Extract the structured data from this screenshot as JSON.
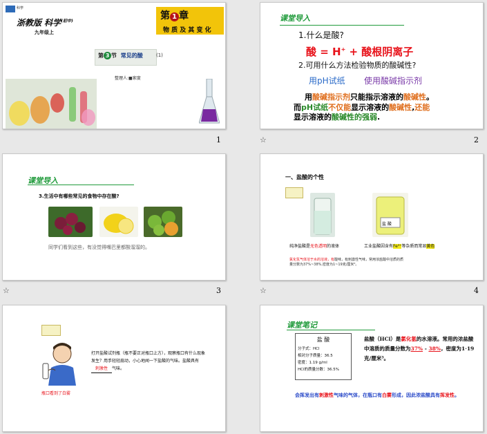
{
  "slides": [
    {
      "number": "1",
      "book_title": "浙教版 科学",
      "book_sub": "(初中)",
      "grade": "九年级上",
      "chapter_label_pre": "第",
      "chapter_number": "1",
      "chapter_label_post": "章",
      "chapter_name": "物 质 及 其 变 化",
      "section_pre": "第",
      "section_number": "3",
      "section_post": "节",
      "section_name": "常见的酸",
      "section_part": "(1)",
      "author": "整理人:■家度",
      "logo_text": "科学"
    },
    {
      "number": "2",
      "heading": "课堂导入",
      "q1": "1.什么是酸?",
      "acid_def_a": "酸 = H",
      "acid_def_sup": "+",
      "acid_def_b": " + 酸根阴离子",
      "q2": "2.可用什么方法检验物质的酸碱性?",
      "method1": "用pH试纸",
      "method2": "使用酸碱指示剂",
      "p_line1": [
        {
          "t": "用",
          "c": "#000000"
        },
        {
          "t": "酸碱指示剂",
          "c": "#e07020"
        },
        {
          "t": "只能指示溶液的",
          "c": "#000000"
        },
        {
          "t": "酸碱性",
          "c": "#e07020"
        },
        {
          "t": "。",
          "c": "#000000"
        }
      ],
      "p_line2": [
        {
          "t": "而",
          "c": "#000000"
        },
        {
          "t": "pH试纸",
          "c": "#2a8a2a"
        },
        {
          "t": "不仅能",
          "c": "#e07020"
        },
        {
          "t": "显示溶液的",
          "c": "#000000"
        },
        {
          "t": "酸碱性",
          "c": "#e07020"
        },
        {
          "t": ",",
          "c": "#000000"
        },
        {
          "t": "还能",
          "c": "#e07020"
        }
      ],
      "p_line3": [
        {
          "t": "显示溶液的",
          "c": "#000000"
        },
        {
          "t": "酸碱性的强弱",
          "c": "#2a8a2a"
        },
        {
          "t": ".",
          "c": "#000000"
        }
      ]
    },
    {
      "number": "3",
      "heading": "课堂导入",
      "q3": "3.生活中有哪些常见的食物中存在酸?",
      "caption": "同学们看到这些，有没觉得嘴巴里都酸溜溜的。"
    },
    {
      "number": "4",
      "heading": "一、盐酸的个性",
      "bottle_label": "盐 酸",
      "cap_left_a": "纯净盐酸是",
      "cap_left_b": "无色透明",
      "cap_left_c": "的液体",
      "cap_right_a": "工业盐酸因含有",
      "cap_right_b": "Fe³⁺",
      "cap_right_c": "等杂质而常显",
      "cap_right_d": "黄色",
      "note_red": "氯化氢气体溶于水的溶液，有",
      "note_rest": "酸味，有刺激性气味，常用浓盐酸中溶质的质量分数为37%~38%,密度为1~19克/厘米³。"
    },
    {
      "number": "",
      "instruction": "打开盐酸试剂瓶（瓶不要正对瓶口上方），观察瓶口有什么现象发生？用手轻轻扇动，小心地闻一下盐酸的气味。盐酸具有",
      "blank": "刺激性",
      "instruction_end": "气味。",
      "red_caption": "瓶口看到了白雾"
    },
    {
      "number": "",
      "heading": "课堂笔记",
      "box_title": "盐  酸",
      "box_lines": [
        "分子式：HCl",
        "相对分子质量：36.5",
        "密度：1.19 g/ml",
        "HCl的质量分数：36.5%"
      ],
      "para_a": "盐酸（HCl）是",
      "para_red": "氯化氢",
      "para_b": "的水溶液。常用的浓盐酸中溶质的质量分数为",
      "para_u1": "37%",
      "para_dash": " - ",
      "para_u2": "38%",
      "para_c": "，密度为1·19克/厘米³。",
      "blue_a": "会挥发出有",
      "blue_red1": "刺激性",
      "blue_b": "气味的气体，在瓶口有",
      "blue_red2": "白雾",
      "blue_c": "形成，因此浓盐酸具有",
      "blue_red3": "挥发性",
      "blue_d": "。"
    }
  ],
  "colors": {
    "green_heading": "#1f9a3a",
    "red": "#e8121a",
    "blue": "#2a6ac8",
    "orange": "#e07020",
    "purple": "#7a3aa8",
    "gold": "#f2c40a"
  }
}
